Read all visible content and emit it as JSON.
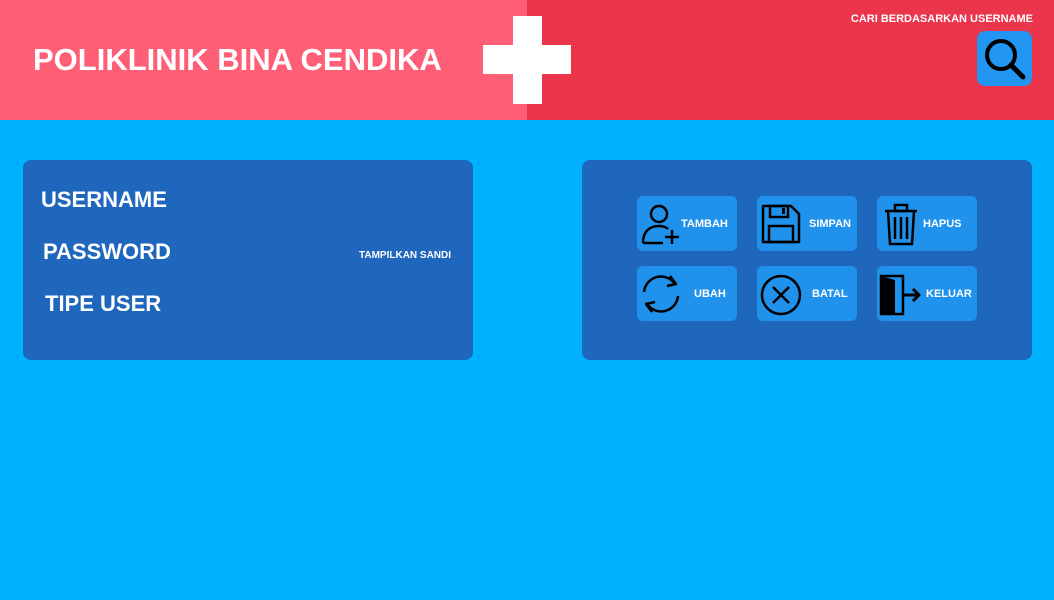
{
  "header": {
    "title": "POLIKLINIK BINA CENDIKA",
    "search_label": "CARI BERDASARKAN USERNAME",
    "search_icon": "search-icon"
  },
  "form": {
    "username_label": "USERNAME",
    "password_label": "PASSWORD",
    "show_password_label": "TAMPILKAN SANDI",
    "user_type_label": "TIPE USER"
  },
  "actions": [
    {
      "label": "TAMBAH",
      "icon": "add-user-icon"
    },
    {
      "label": "SIMPAN",
      "icon": "save-icon"
    },
    {
      "label": "HAPUS",
      "icon": "trash-icon"
    },
    {
      "label": "UBAH",
      "icon": "refresh-icon"
    },
    {
      "label": "BATAL",
      "icon": "cancel-icon"
    },
    {
      "label": "KELUAR",
      "icon": "exit-icon"
    }
  ],
  "colors": {
    "background": "#00b1fe",
    "header_left": "#ff5f76",
    "header_right": "#ea354b",
    "panel": "#1f66bd",
    "button": "#2092ec",
    "search_button": "#2196f3"
  }
}
